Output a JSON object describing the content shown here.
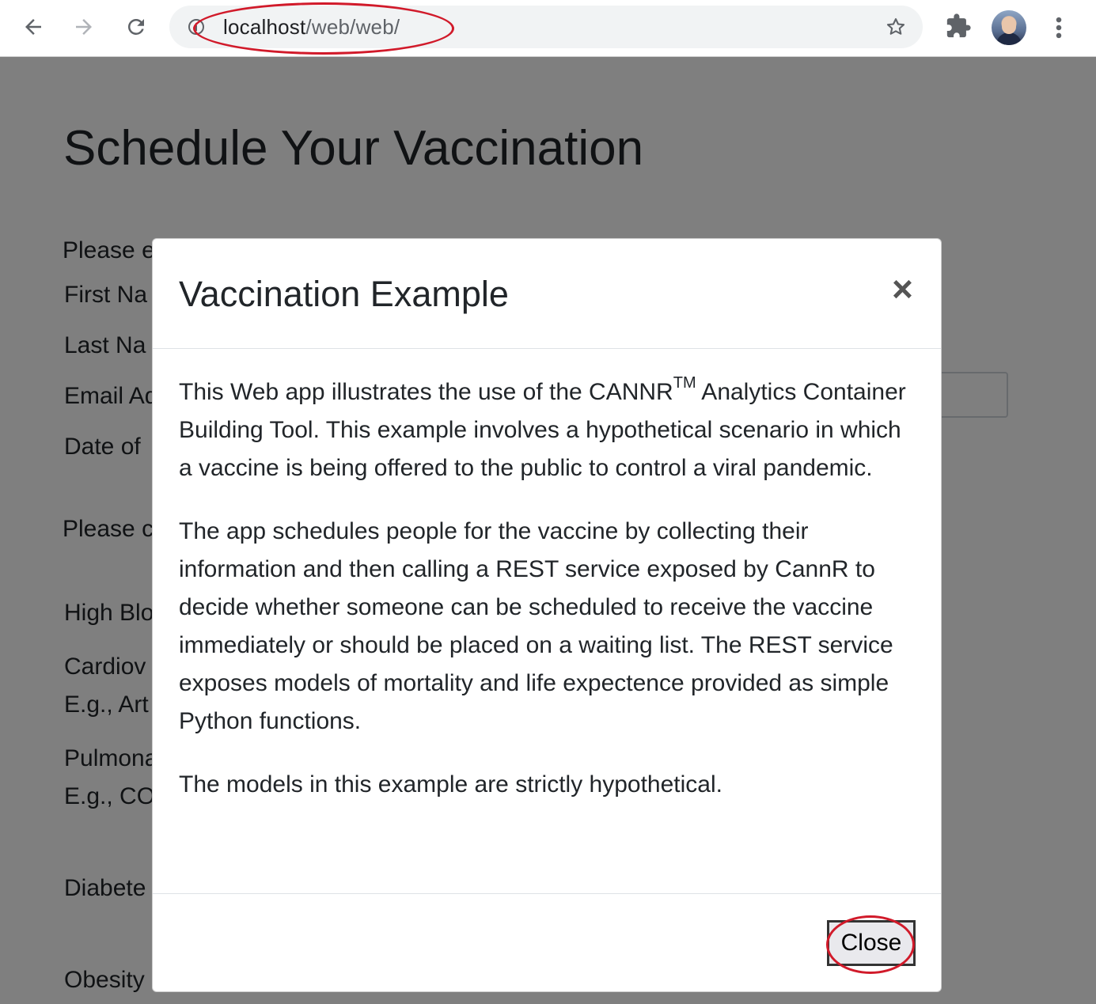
{
  "browser": {
    "url_host": "localhost",
    "url_path": "/web/web/"
  },
  "page": {
    "title": "Schedule Your Vaccination",
    "labels": {
      "intro1": "Please e",
      "first_name": "First Na",
      "last_name": "Last Na",
      "email": "Email Ad",
      "dob": "Date of",
      "intro2": "Please c",
      "high_blood": "High Blo",
      "cardio": "Cardiov",
      "cardio_eg": "E.g., Art",
      "pulmonary": "Pulmona",
      "pulmonary_eg": "E.g., CO",
      "diabetes": "Diabete",
      "obesity": "Obesity"
    }
  },
  "modal": {
    "title": "Vaccination Example",
    "close_symbol": "×",
    "p1_before": "This Web app illustrates the use of the CANNR",
    "p1_sup": "TM",
    "p1_after": " Analytics Container Building Tool. This example involves a hypothetical scenario in which a vaccine is being offered to the public to control a viral pandemic.",
    "p2": "The app schedules people for the vaccine by collecting their information and then calling a REST service exposed by CannR to decide whether someone can be scheduled to receive the vaccine immediately or should be placed on a waiting list. The REST service exposes models of mortality and life expectence provided as simple Python functions.",
    "p3": "The models in this example are strictly hypothetical.",
    "close_button": "Close"
  },
  "annotations": {
    "highlight_color": "#d11a2a"
  }
}
